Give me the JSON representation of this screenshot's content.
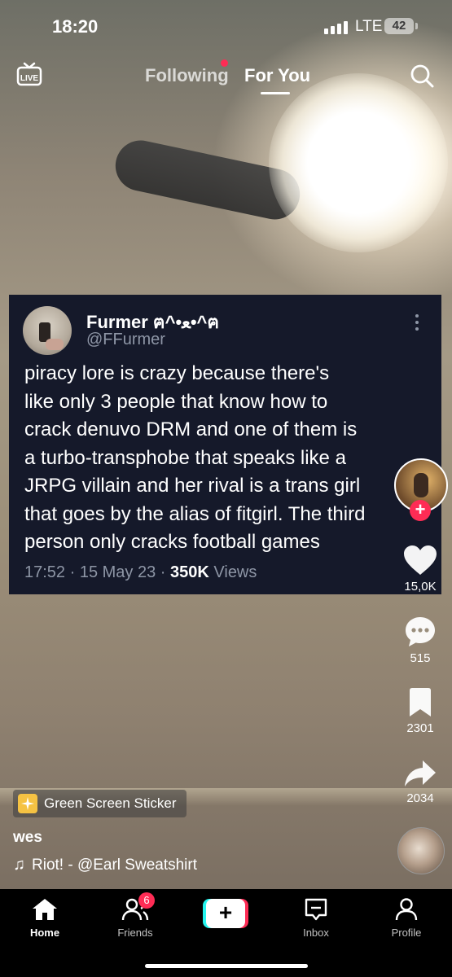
{
  "status_bar": {
    "time": "18:20",
    "network": "LTE",
    "battery": "42"
  },
  "top_nav": {
    "live_label": "LIVE",
    "tab_following": "Following",
    "tab_for_you": "For You"
  },
  "tweet": {
    "name": "Furmer ฅ^•ﻌ•^ฅ",
    "handle": "@FFurmer",
    "lines": [
      "piracy lore is crazy because there's",
      "like only 3 people that know how to",
      "crack denuvo DRM and one of them is",
      "a turbo-transphobe that speaks like a",
      "JRPG villain and her rival is a trans girl",
      "that goes by the alias of fitgirl. The third",
      "person only cracks football games"
    ],
    "time": "17:52",
    "date": "15 May 23",
    "views": "350K",
    "views_label": "Views"
  },
  "rail": {
    "likes": "15,0K",
    "comments": "515",
    "saves": "2301",
    "shares": "2034",
    "follow_symbol": "+"
  },
  "video_info": {
    "sticker_label": "Green Screen Sticker",
    "username": "wes",
    "music_note": "♫",
    "music": "Riot! - @Earl Sweatshirt"
  },
  "bottom_nav": {
    "home": "Home",
    "friends": "Friends",
    "friends_badge": "6",
    "create_symbol": "+",
    "inbox": "Inbox",
    "profile": "Profile"
  },
  "colors": {
    "accent": "#fe2c55",
    "cyan": "#25f4ee",
    "tweet_bg": "#15192a"
  }
}
